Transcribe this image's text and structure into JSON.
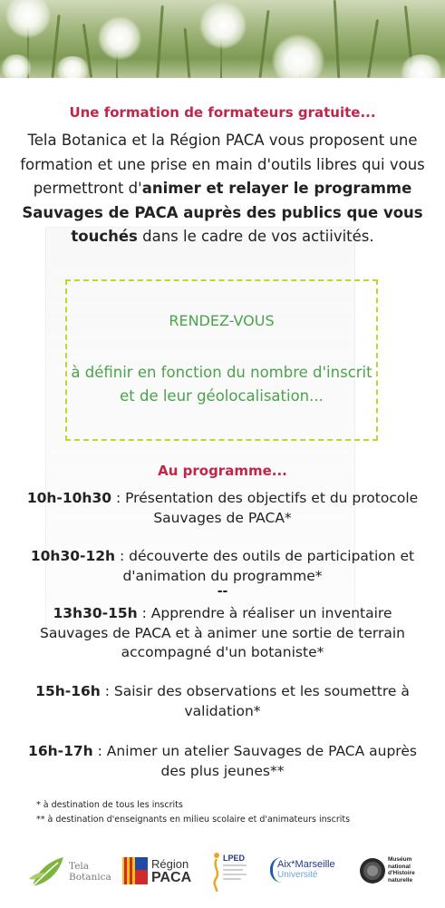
{
  "intro": {
    "title": "Une formation de formateurs gratuite...",
    "text_pre": "Tela Botanica et la Région PACA vous proposent une formation et une prise en main d'outils libres qui vous permettront d'",
    "text_bold": "animer et relayer le programme Sauvages de PACA auprès des publics que vous touchés",
    "text_post": " dans le cadre de vos actiivités."
  },
  "rendezvous": {
    "title": "RENDEZ-VOUS",
    "text": "à définir en fonction du nombre d'inscrit et de leur géolocalisation..."
  },
  "programme": {
    "title": "Au programme...",
    "separator": "--",
    "items": [
      {
        "time": "10h-10h30",
        "text": " : Présentation des objectifs et du protocole Sauvages de PACA*"
      },
      {
        "time": "10h30-12h",
        "text": " : découverte des outils de participation et d'animation du programme*"
      },
      {
        "time": "13h30-15h",
        "text": " : Apprendre à réaliser un inventaire Sauvages de PACA et à animer une sortie de terrain accompagné d'un botaniste*"
      },
      {
        "time": "15h-16h",
        "text": " : Saisir des observations et les soumettre à validation*"
      },
      {
        "time": "16h-17h",
        "text": " : Animer un atelier Sauvages de PACA auprès des plus jeunes**"
      }
    ]
  },
  "footnotes": [
    "* à destination de tous les inscrits",
    "** à destination d'enseignants en milieu scolaire et d'animateurs inscrits"
  ],
  "logos": {
    "tela_line1": "Tela",
    "tela_line2": "Botanica",
    "region_line1": "Région",
    "region_line2": "PACA",
    "lped": "LPED",
    "amu_line1": "Aix*Marseille",
    "amu_line2": "Université",
    "museum_line1": "Muséum",
    "museum_line2": "national",
    "museum_line3": "d'Histoire",
    "museum_line4": "naturelle"
  },
  "colors": {
    "accent_red": "#c0254a",
    "accent_green": "#4aa34a",
    "dash_border": "#c3d52b"
  }
}
